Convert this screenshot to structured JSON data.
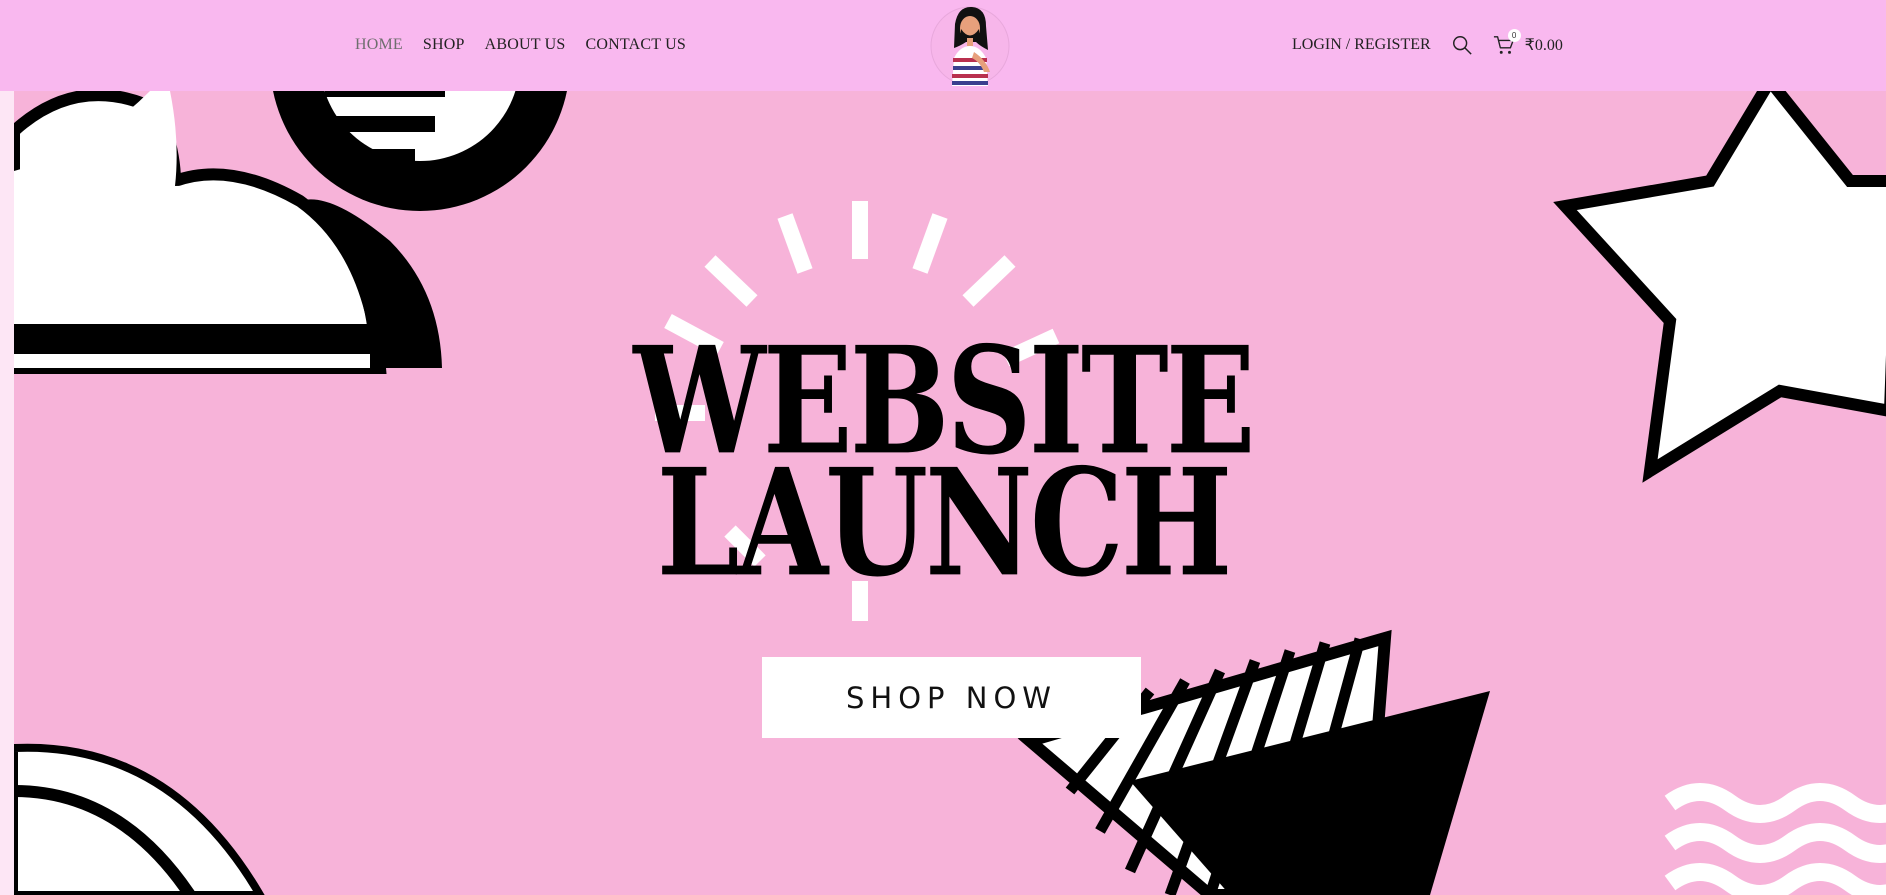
{
  "header": {
    "nav": [
      {
        "label": "HOME"
      },
      {
        "label": "SHOP"
      },
      {
        "label": "ABOUT US"
      },
      {
        "label": "CONTACT US"
      }
    ],
    "login_label": "LOGIN / REGISTER",
    "cart": {
      "count": "0",
      "total": "₹0.00"
    },
    "icons": {
      "search": "search-icon",
      "cart": "cart-icon",
      "logo": "girl-avatar-logo"
    }
  },
  "hero": {
    "title_line1": "WEBSITE",
    "title_line2": "LAUNCH",
    "button_label": "SHOP NOW"
  },
  "colors": {
    "header_bg": "#f9b8ef",
    "hero_bg": "#f7b3d9",
    "ink": "#000000",
    "button_bg": "#ffffff"
  }
}
